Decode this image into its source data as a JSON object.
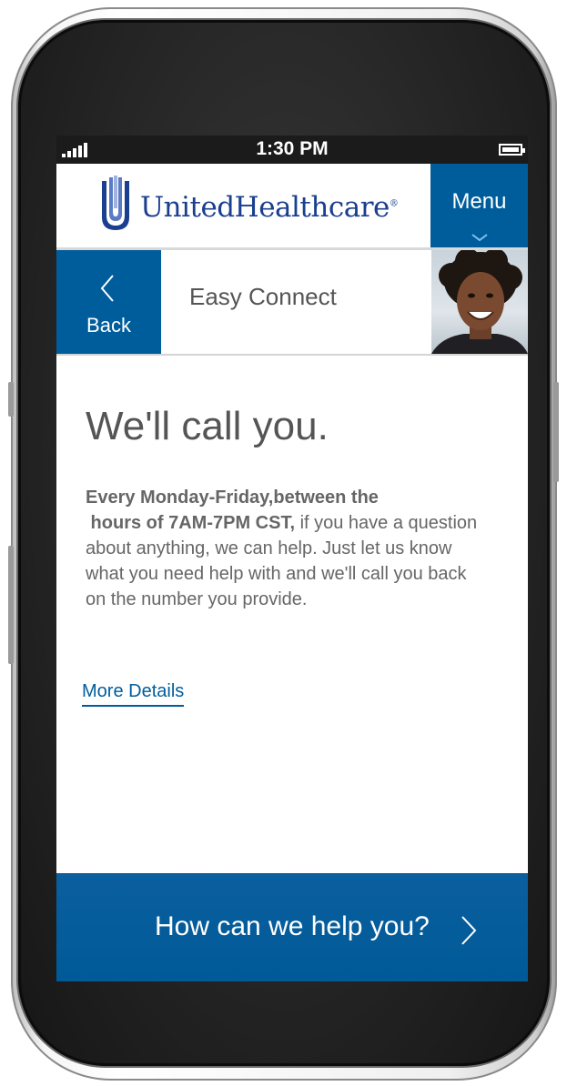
{
  "status_bar": {
    "time": "1:30 PM"
  },
  "header": {
    "brand_name": "UnitedHealthcare",
    "brand_reg": "®",
    "menu_label": "Menu"
  },
  "subheader": {
    "back_label": "Back",
    "title": "Easy Connect"
  },
  "main": {
    "title": "We'll call you.",
    "intro_bold_line1": "Every Monday-Friday,between the",
    "intro_bold_line2": " hours of 7AM-7PM CST,",
    "intro_rest": " if you have a question about anything, we can help. Just let us know what you need help with and we'll call you back on the number you provide.",
    "more_details_label": "More Details"
  },
  "help_bar": {
    "label": "How can we help you?"
  },
  "icons": {
    "signal": "signal-icon",
    "battery": "battery-icon",
    "logo": "unitedhealthcare-logo-icon",
    "menu_chevron": "chevron-down-icon",
    "back": "chevron-left-icon",
    "help_chevron": "chevron-right-icon"
  },
  "colors": {
    "primary_blue": "#005d9c",
    "logo_blue": "#1a3f8f",
    "text_gray": "#555555",
    "status_bar": "#1b1b1b"
  }
}
